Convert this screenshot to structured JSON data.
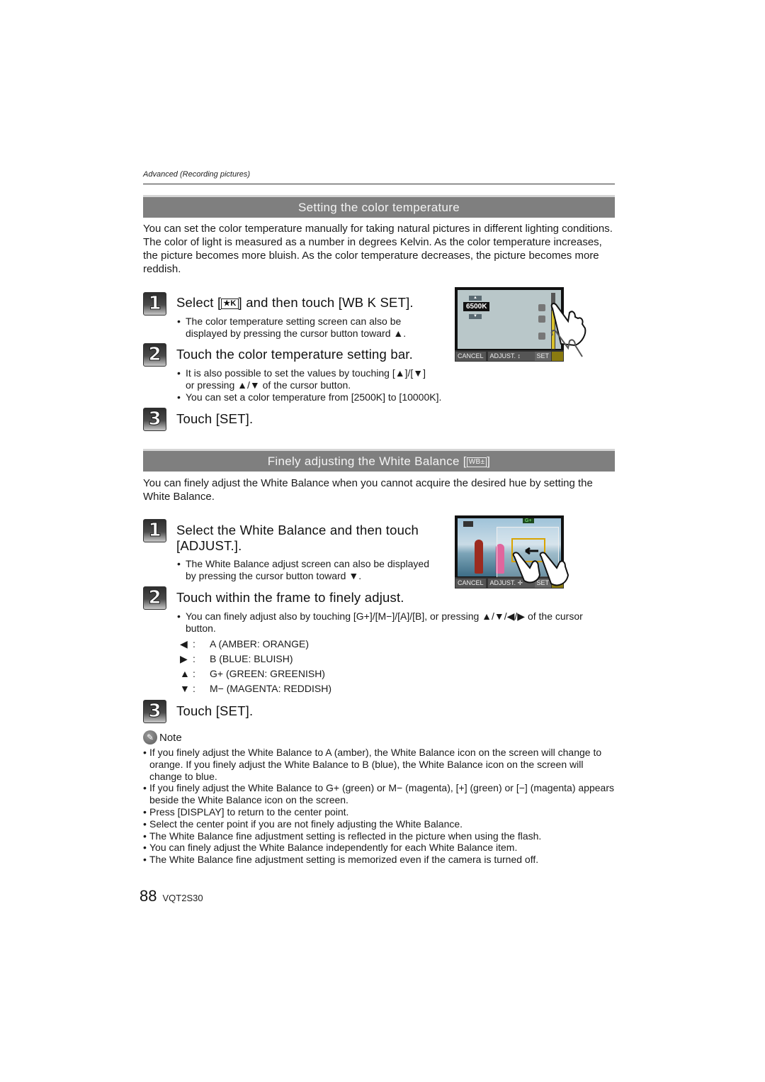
{
  "running_head": "Advanced (Recording pictures)",
  "section1": {
    "title": "Setting the color temperature",
    "intro": "You can set the color temperature manually for taking natural pictures in different lighting conditions. The color of light is measured as a number in degrees Kelvin. As the color temperature increases, the picture becomes more bluish. As the color temperature decreases, the picture becomes more reddish.",
    "steps": [
      {
        "number": "1",
        "title_before": "Select [",
        "title_icon": "★K",
        "title_after": "] and then touch [WB K SET].",
        "bullets": [
          "The color temperature setting screen can also be displayed by pressing the cursor button toward ▲."
        ]
      },
      {
        "number": "2",
        "title": "Touch the color temperature setting bar.",
        "bullets": [
          "It is also possible to set the values by touching [▲]/[▼] or pressing ▲/▼ of the cursor button.",
          "You can set a color temperature from [2500K] to [10000K]."
        ]
      },
      {
        "number": "3",
        "title": "Touch [SET]."
      }
    ],
    "screenshot": {
      "value": "6500K",
      "cancel": "CANCEL",
      "adjust": "ADJUST. ↕",
      "set": "SET"
    }
  },
  "section2": {
    "title_before": "Finely adjusting the White Balance [",
    "title_icon": "WB±",
    "title_after": "]",
    "intro": "You can finely adjust the White Balance when you cannot acquire the desired hue by setting the White Balance.",
    "steps": [
      {
        "number": "1",
        "title_line1": "Select the White Balance and then touch",
        "title_line2": "[ADJUST.].",
        "bullets": [
          "The White Balance adjust screen can also be displayed by pressing the cursor button toward ▼."
        ]
      },
      {
        "number": "2",
        "title": "Touch within the frame to finely adjust.",
        "bullets": [
          "You can finely adjust also by touching [G+]/[M−]/[A]/[B], or pressing ▲/▼/◀/▶ of the cursor button."
        ]
      },
      {
        "number": "3",
        "title": "Touch [SET]."
      }
    ],
    "keys": [
      {
        "symbol": "◀",
        "label": "A (AMBER: ORANGE)"
      },
      {
        "symbol": "▶",
        "label": "B (BLUE: BLUISH)"
      },
      {
        "symbol": "▲",
        "label": "G+ (GREEN: GREENISH)"
      },
      {
        "symbol": "▼",
        "label": "M− (MAGENTA: REDDISH)"
      }
    ],
    "screenshot": {
      "gplus": "G+",
      "bkt": "BKT",
      "cancel": "CANCEL",
      "adjust": "ADJUST. ✛",
      "set": "SET"
    }
  },
  "note": {
    "label": "Note",
    "items": [
      "If you finely adjust the White Balance to A (amber), the White Balance icon on the screen will change to orange. If you finely adjust the White Balance to B (blue), the White Balance icon on the screen will change to blue.",
      "If you finely adjust the White Balance to G+ (green) or M− (magenta), [+] (green) or [−] (magenta) appears beside the White Balance icon on the screen.",
      "Press [DISPLAY] to return to the center point.",
      "Select the center point if you are not finely adjusting the White Balance.",
      "The White Balance fine adjustment setting is reflected in the picture when using the flash.",
      "You can finely adjust the White Balance independently for each White Balance item.",
      "The White Balance fine adjustment setting is memorized even if the camera is turned off."
    ]
  },
  "footer": {
    "page_number": "88",
    "model_code": "VQT2S30"
  },
  "bullet_char": "•",
  "colon": ":"
}
